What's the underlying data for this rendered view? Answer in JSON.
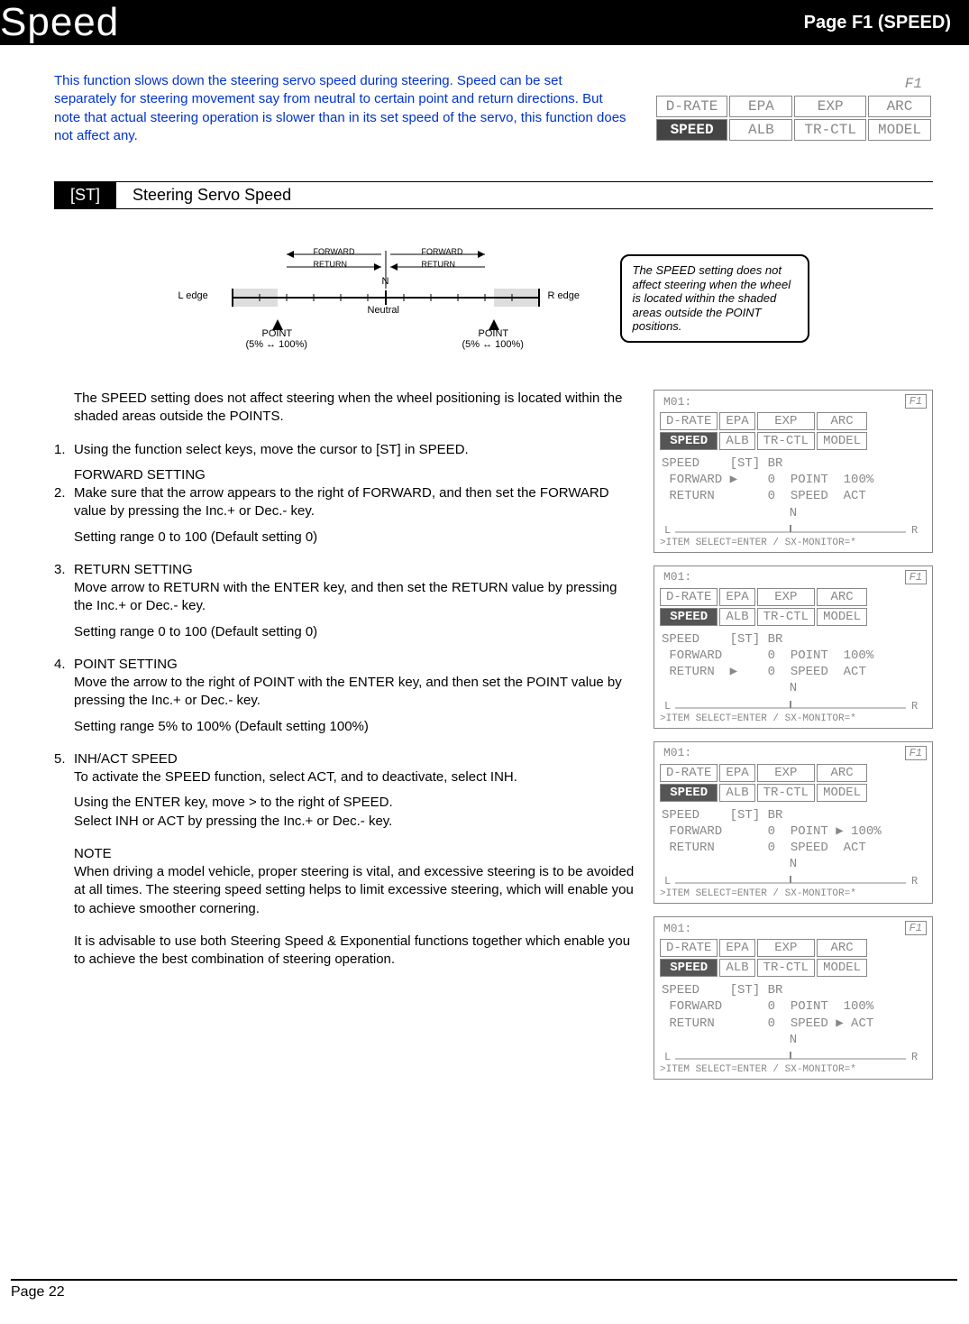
{
  "header": {
    "title": "Speed",
    "page": "Page F1 (SPEED)"
  },
  "intro": "This function slows down the steering servo speed during steering. Speed can be set separately for steering movement say from neutral to certain point and return directions. But note that actual steering operation is slower than in its set speed of the servo, this function does not affect any.",
  "menu": {
    "corner": "F1",
    "row1": [
      "D-RATE",
      "EPA",
      "EXP",
      "ARC"
    ],
    "row2": [
      "SPEED",
      "ALB",
      "TR-CTL",
      "MODEL"
    ],
    "active": "SPEED"
  },
  "section": {
    "tag": "[ST]",
    "title": "Steering Servo Speed"
  },
  "diagram": {
    "l_edge": "L edge",
    "r_edge": "R edge",
    "forward": "FORWARD",
    "return": "RETURN",
    "n": "N",
    "neutral": "Neutral",
    "point": "POINT",
    "range": "(5% ↔ 100%)"
  },
  "note": "The SPEED setting does not affect steering when the wheel is located within the shaded areas outside the POINT positions.",
  "lead": "The SPEED setting does not affect steering when the wheel positioning is located within the shaded areas outside the POINTS.",
  "steps": [
    {
      "num": "1.",
      "body": "Using the function select keys, move the cursor to [ST] in SPEED."
    },
    {
      "head": "FORWARD SETTING",
      "num": "2.",
      "body": "Make sure that the arrow appears to the right of FORWARD, and then set the FORWARD value by pressing the Inc.+ or Dec.- key.",
      "range": "Setting range 0 to 100 (Default setting  0)"
    },
    {
      "head": "RETURN SETTING",
      "num": "3.",
      "body": "Move arrow to RETURN with the ENTER key, and then set the RETURN value by pressing the Inc.+ or Dec.- key.",
      "range": "Setting range 0 to 100 (Default setting  0)"
    },
    {
      "head": "POINT SETTING",
      "num": "4.",
      "body": "Move the arrow to the right of POINT with the ENTER key, and then set the POINT value by pressing the Inc.+ or Dec.- key.",
      "range": "Setting range 5% to 100% (Default setting 100%)"
    },
    {
      "head": "INH/ACT SPEED",
      "num": "5.",
      "body": "To activate the SPEED function, select ACT, and to deactivate, select INH.",
      "extra1": "Using the ENTER key, move > to the right of SPEED.",
      "extra2": "Select INH or ACT by pressing the Inc.+ or Dec.- key."
    }
  ],
  "note_head": "NOTE",
  "note1": "When driving a model vehicle, proper steering is vital, and excessive steering is to be avoided at all times. The steering speed setting helps to limit excessive steering, which will enable you to achieve smoother cornering.",
  "note2": "It is advisable to use both Steering Speed & Exponential functions together which enable you to achieve the best combination of steering operation.",
  "screens": [
    {
      "m": "M01:",
      "f1": "F1",
      "title": "SPEED    [ST] BR",
      "l1": " FORWARD ▶    0  POINT  100%",
      "l2": " RETURN       0  SPEED  ACT",
      "footer": ">ITEM SELECT=ENTER / SX-MONITOR=*"
    },
    {
      "m": "M01:",
      "f1": "F1",
      "title": "SPEED    [ST] BR",
      "l1": " FORWARD      0  POINT  100%",
      "l2": " RETURN  ▶    0  SPEED  ACT",
      "footer": ">ITEM SELECT=ENTER / SX-MONITOR=*"
    },
    {
      "m": "M01:",
      "f1": "F1",
      "title": "SPEED    [ST] BR",
      "l1": " FORWARD      0  POINT ▶ 100%",
      "l2": " RETURN       0  SPEED  ACT",
      "footer": ">ITEM SELECT=ENTER / SX-MONITOR=*"
    },
    {
      "m": "M01:",
      "f1": "F1",
      "title": "SPEED    [ST] BR",
      "l1": " FORWARD      0  POINT  100%",
      "l2": " RETURN       0  SPEED ▶ ACT",
      "footer": ">ITEM SELECT=ENTER / SX-MONITOR=*"
    }
  ],
  "page_footer": "Page 22"
}
